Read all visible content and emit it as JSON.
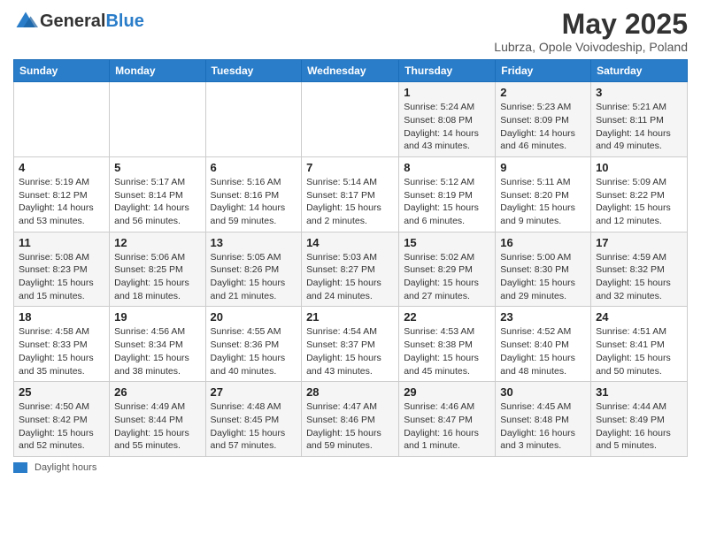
{
  "header": {
    "logo_general": "General",
    "logo_blue": "Blue",
    "title": "May 2025",
    "subtitle": "Lubrza, Opole Voivodeship, Poland"
  },
  "weekdays": [
    "Sunday",
    "Monday",
    "Tuesday",
    "Wednesday",
    "Thursday",
    "Friday",
    "Saturday"
  ],
  "weeks": [
    [
      {
        "day": "",
        "info": ""
      },
      {
        "day": "",
        "info": ""
      },
      {
        "day": "",
        "info": ""
      },
      {
        "day": "",
        "info": ""
      },
      {
        "day": "1",
        "info": "Sunrise: 5:24 AM\nSunset: 8:08 PM\nDaylight: 14 hours\nand 43 minutes."
      },
      {
        "day": "2",
        "info": "Sunrise: 5:23 AM\nSunset: 8:09 PM\nDaylight: 14 hours\nand 46 minutes."
      },
      {
        "day": "3",
        "info": "Sunrise: 5:21 AM\nSunset: 8:11 PM\nDaylight: 14 hours\nand 49 minutes."
      }
    ],
    [
      {
        "day": "4",
        "info": "Sunrise: 5:19 AM\nSunset: 8:12 PM\nDaylight: 14 hours\nand 53 minutes."
      },
      {
        "day": "5",
        "info": "Sunrise: 5:17 AM\nSunset: 8:14 PM\nDaylight: 14 hours\nand 56 minutes."
      },
      {
        "day": "6",
        "info": "Sunrise: 5:16 AM\nSunset: 8:16 PM\nDaylight: 14 hours\nand 59 minutes."
      },
      {
        "day": "7",
        "info": "Sunrise: 5:14 AM\nSunset: 8:17 PM\nDaylight: 15 hours\nand 2 minutes."
      },
      {
        "day": "8",
        "info": "Sunrise: 5:12 AM\nSunset: 8:19 PM\nDaylight: 15 hours\nand 6 minutes."
      },
      {
        "day": "9",
        "info": "Sunrise: 5:11 AM\nSunset: 8:20 PM\nDaylight: 15 hours\nand 9 minutes."
      },
      {
        "day": "10",
        "info": "Sunrise: 5:09 AM\nSunset: 8:22 PM\nDaylight: 15 hours\nand 12 minutes."
      }
    ],
    [
      {
        "day": "11",
        "info": "Sunrise: 5:08 AM\nSunset: 8:23 PM\nDaylight: 15 hours\nand 15 minutes."
      },
      {
        "day": "12",
        "info": "Sunrise: 5:06 AM\nSunset: 8:25 PM\nDaylight: 15 hours\nand 18 minutes."
      },
      {
        "day": "13",
        "info": "Sunrise: 5:05 AM\nSunset: 8:26 PM\nDaylight: 15 hours\nand 21 minutes."
      },
      {
        "day": "14",
        "info": "Sunrise: 5:03 AM\nSunset: 8:27 PM\nDaylight: 15 hours\nand 24 minutes."
      },
      {
        "day": "15",
        "info": "Sunrise: 5:02 AM\nSunset: 8:29 PM\nDaylight: 15 hours\nand 27 minutes."
      },
      {
        "day": "16",
        "info": "Sunrise: 5:00 AM\nSunset: 8:30 PM\nDaylight: 15 hours\nand 29 minutes."
      },
      {
        "day": "17",
        "info": "Sunrise: 4:59 AM\nSunset: 8:32 PM\nDaylight: 15 hours\nand 32 minutes."
      }
    ],
    [
      {
        "day": "18",
        "info": "Sunrise: 4:58 AM\nSunset: 8:33 PM\nDaylight: 15 hours\nand 35 minutes."
      },
      {
        "day": "19",
        "info": "Sunrise: 4:56 AM\nSunset: 8:34 PM\nDaylight: 15 hours\nand 38 minutes."
      },
      {
        "day": "20",
        "info": "Sunrise: 4:55 AM\nSunset: 8:36 PM\nDaylight: 15 hours\nand 40 minutes."
      },
      {
        "day": "21",
        "info": "Sunrise: 4:54 AM\nSunset: 8:37 PM\nDaylight: 15 hours\nand 43 minutes."
      },
      {
        "day": "22",
        "info": "Sunrise: 4:53 AM\nSunset: 8:38 PM\nDaylight: 15 hours\nand 45 minutes."
      },
      {
        "day": "23",
        "info": "Sunrise: 4:52 AM\nSunset: 8:40 PM\nDaylight: 15 hours\nand 48 minutes."
      },
      {
        "day": "24",
        "info": "Sunrise: 4:51 AM\nSunset: 8:41 PM\nDaylight: 15 hours\nand 50 minutes."
      }
    ],
    [
      {
        "day": "25",
        "info": "Sunrise: 4:50 AM\nSunset: 8:42 PM\nDaylight: 15 hours\nand 52 minutes."
      },
      {
        "day": "26",
        "info": "Sunrise: 4:49 AM\nSunset: 8:44 PM\nDaylight: 15 hours\nand 55 minutes."
      },
      {
        "day": "27",
        "info": "Sunrise: 4:48 AM\nSunset: 8:45 PM\nDaylight: 15 hours\nand 57 minutes."
      },
      {
        "day": "28",
        "info": "Sunrise: 4:47 AM\nSunset: 8:46 PM\nDaylight: 15 hours\nand 59 minutes."
      },
      {
        "day": "29",
        "info": "Sunrise: 4:46 AM\nSunset: 8:47 PM\nDaylight: 16 hours\nand 1 minute."
      },
      {
        "day": "30",
        "info": "Sunrise: 4:45 AM\nSunset: 8:48 PM\nDaylight: 16 hours\nand 3 minutes."
      },
      {
        "day": "31",
        "info": "Sunrise: 4:44 AM\nSunset: 8:49 PM\nDaylight: 16 hours\nand 5 minutes."
      }
    ]
  ],
  "footer": {
    "label": "Daylight hours"
  }
}
